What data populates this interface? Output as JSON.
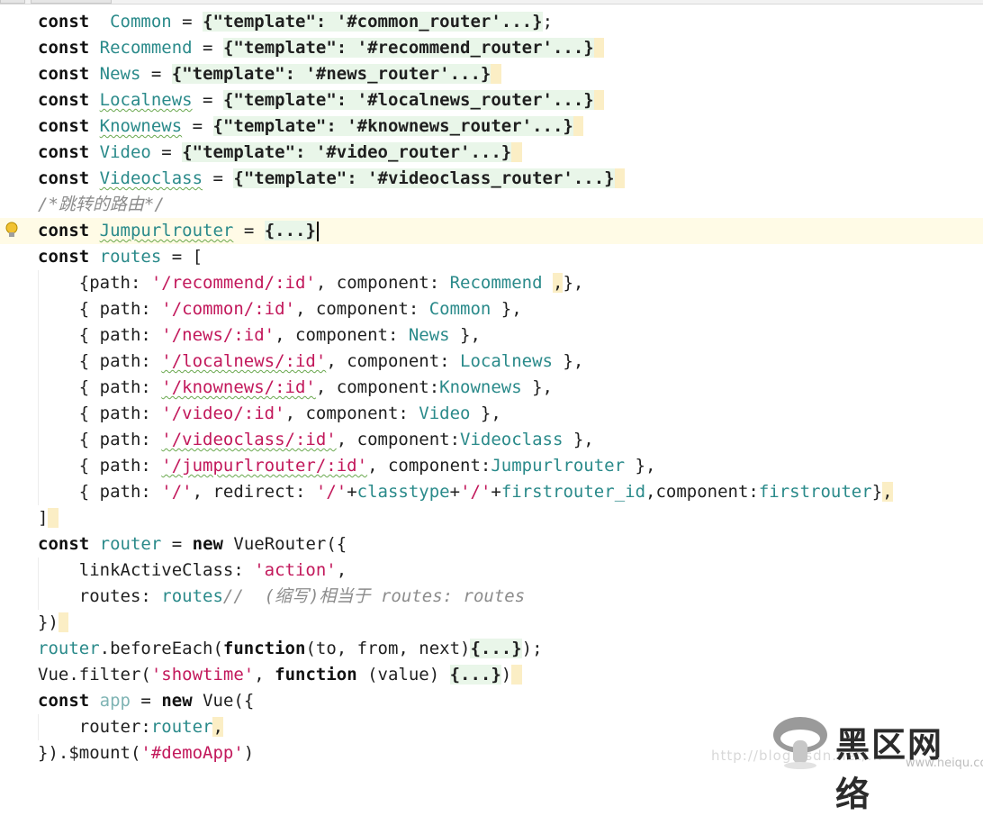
{
  "editor": {
    "language": "javascript",
    "lines": [
      {
        "tokens": [
          {
            "t": "const",
            "c": "kw"
          },
          {
            "t": "  ",
            "c": "plain"
          },
          {
            "t": "Common",
            "c": "ident"
          },
          {
            "t": " = ",
            "c": "plain"
          },
          {
            "t": "{\"template\": '#common_router'...}",
            "c": "foldstr"
          },
          {
            "t": ";",
            "c": "plain"
          }
        ]
      },
      {
        "tokens": [
          {
            "t": "const",
            "c": "kw"
          },
          {
            "t": " ",
            "c": "plain"
          },
          {
            "t": "Recommend",
            "c": "ident"
          },
          {
            "t": " = ",
            "c": "plain"
          },
          {
            "t": "{\"template\": '#recommend_router'...}",
            "c": "foldstr"
          },
          {
            "t": " ",
            "c": "hl"
          }
        ]
      },
      {
        "tokens": [
          {
            "t": "const",
            "c": "kw"
          },
          {
            "t": " ",
            "c": "plain"
          },
          {
            "t": "News",
            "c": "ident"
          },
          {
            "t": " = ",
            "c": "plain"
          },
          {
            "t": "{\"template\": '#news_router'...}",
            "c": "foldstr"
          },
          {
            "t": " ",
            "c": "hl"
          }
        ]
      },
      {
        "tokens": [
          {
            "t": "const",
            "c": "kw"
          },
          {
            "t": " ",
            "c": "plain"
          },
          {
            "t": "Localnews",
            "c": "ident squig"
          },
          {
            "t": " = ",
            "c": "plain"
          },
          {
            "t": "{\"template\": '#localnews_router'...}",
            "c": "foldstr"
          },
          {
            "t": " ",
            "c": "hl"
          }
        ]
      },
      {
        "tokens": [
          {
            "t": "const",
            "c": "kw"
          },
          {
            "t": " ",
            "c": "plain"
          },
          {
            "t": "Knownews",
            "c": "ident squig"
          },
          {
            "t": " = ",
            "c": "plain"
          },
          {
            "t": "{\"template\": '#knownews_router'...}",
            "c": "foldstr"
          },
          {
            "t": " ",
            "c": "hl"
          }
        ]
      },
      {
        "tokens": [
          {
            "t": "const",
            "c": "kw"
          },
          {
            "t": " ",
            "c": "plain"
          },
          {
            "t": "Video",
            "c": "ident"
          },
          {
            "t": " = ",
            "c": "plain"
          },
          {
            "t": "{\"template\": '#video_router'...}",
            "c": "foldstr"
          },
          {
            "t": " ",
            "c": "hl"
          }
        ]
      },
      {
        "tokens": [
          {
            "t": "const",
            "c": "kw"
          },
          {
            "t": " ",
            "c": "plain"
          },
          {
            "t": "Videoclass",
            "c": "ident squig"
          },
          {
            "t": " = ",
            "c": "plain"
          },
          {
            "t": "{\"template\": '#videoclass_router'...}",
            "c": "foldstr"
          },
          {
            "t": " ",
            "c": "hl"
          }
        ]
      },
      {
        "tokens": [
          {
            "t": "/*跳转的路由*/",
            "c": "cm"
          }
        ]
      },
      {
        "current": true,
        "bulb": true,
        "tokens": [
          {
            "t": "const",
            "c": "kw"
          },
          {
            "t": " ",
            "c": "plain"
          },
          {
            "t": "Jumpurlrouter",
            "c": "ident squig"
          },
          {
            "t": " = ",
            "c": "plain"
          },
          {
            "t": "{...}",
            "c": "fold"
          },
          {
            "t": "",
            "c": "caret"
          }
        ]
      },
      {
        "tokens": [
          {
            "t": "const",
            "c": "kw"
          },
          {
            "t": " ",
            "c": "plain"
          },
          {
            "t": "routes",
            "c": "ident"
          },
          {
            "t": " = [",
            "c": "plain"
          }
        ]
      },
      {
        "guide": true,
        "tokens": [
          {
            "t": "    {path: ",
            "c": "plain"
          },
          {
            "t": "'/recommend/:id'",
            "c": "str"
          },
          {
            "t": ", component: ",
            "c": "plain"
          },
          {
            "t": "Recommend",
            "c": "ident"
          },
          {
            "t": " ",
            "c": "plain"
          },
          {
            "t": ",",
            "c": "hl"
          },
          {
            "t": "},",
            "c": "plain"
          }
        ]
      },
      {
        "guide": true,
        "tokens": [
          {
            "t": "    { path: ",
            "c": "plain"
          },
          {
            "t": "'/common/:id'",
            "c": "str"
          },
          {
            "t": ", component: ",
            "c": "plain"
          },
          {
            "t": "Common",
            "c": "ident"
          },
          {
            "t": " },",
            "c": "plain"
          }
        ]
      },
      {
        "guide": true,
        "tokens": [
          {
            "t": "    { path: ",
            "c": "plain"
          },
          {
            "t": "'/news/:id'",
            "c": "str"
          },
          {
            "t": ", component: ",
            "c": "plain"
          },
          {
            "t": "News",
            "c": "ident"
          },
          {
            "t": " },",
            "c": "plain"
          }
        ]
      },
      {
        "guide": true,
        "tokens": [
          {
            "t": "    { path: ",
            "c": "plain"
          },
          {
            "t": "'/localnews/:id'",
            "c": "str squig"
          },
          {
            "t": ", component: ",
            "c": "plain"
          },
          {
            "t": "Localnews",
            "c": "ident"
          },
          {
            "t": " },",
            "c": "plain"
          }
        ]
      },
      {
        "guide": true,
        "tokens": [
          {
            "t": "    { path: ",
            "c": "plain"
          },
          {
            "t": "'/knownews/:id'",
            "c": "str squig"
          },
          {
            "t": ", component:",
            "c": "plain"
          },
          {
            "t": "Knownews",
            "c": "ident"
          },
          {
            "t": " },",
            "c": "plain"
          }
        ]
      },
      {
        "guide": true,
        "tokens": [
          {
            "t": "    { path: ",
            "c": "plain"
          },
          {
            "t": "'/video/:id'",
            "c": "str"
          },
          {
            "t": ", component: ",
            "c": "plain"
          },
          {
            "t": "Video",
            "c": "ident"
          },
          {
            "t": " },",
            "c": "plain"
          }
        ]
      },
      {
        "guide": true,
        "tokens": [
          {
            "t": "    { path: ",
            "c": "plain"
          },
          {
            "t": "'/videoclass/:id'",
            "c": "str squig"
          },
          {
            "t": ", component:",
            "c": "plain"
          },
          {
            "t": "Videoclass",
            "c": "ident"
          },
          {
            "t": " },",
            "c": "plain"
          }
        ]
      },
      {
        "guide": true,
        "tokens": [
          {
            "t": "    { path: ",
            "c": "plain"
          },
          {
            "t": "'/jumpurlrouter/:id'",
            "c": "str squig"
          },
          {
            "t": ", component:",
            "c": "plain"
          },
          {
            "t": "Jumpurlrouter",
            "c": "ident"
          },
          {
            "t": " },",
            "c": "plain"
          }
        ]
      },
      {
        "guide": true,
        "tokens": [
          {
            "t": "    { path: ",
            "c": "plain"
          },
          {
            "t": "'/'",
            "c": "str"
          },
          {
            "t": ", redirect: ",
            "c": "plain"
          },
          {
            "t": "'/'",
            "c": "str"
          },
          {
            "t": "+",
            "c": "plain"
          },
          {
            "t": "classtype",
            "c": "ident"
          },
          {
            "t": "+",
            "c": "plain"
          },
          {
            "t": "'/'",
            "c": "str"
          },
          {
            "t": "+",
            "c": "plain"
          },
          {
            "t": "firstrouter_id",
            "c": "ident"
          },
          {
            "t": ",component:",
            "c": "plain"
          },
          {
            "t": "firstrouter",
            "c": "ident"
          },
          {
            "t": "}",
            "c": "plain"
          },
          {
            "t": ",",
            "c": "hl"
          }
        ]
      },
      {
        "tokens": [
          {
            "t": "]",
            "c": "plain"
          },
          {
            "t": " ",
            "c": "hl"
          }
        ]
      },
      {
        "tokens": [
          {
            "t": "const",
            "c": "kw"
          },
          {
            "t": " ",
            "c": "plain"
          },
          {
            "t": "router",
            "c": "ident"
          },
          {
            "t": " = ",
            "c": "plain"
          },
          {
            "t": "new",
            "c": "kw"
          },
          {
            "t": " VueRouter({",
            "c": "plain"
          }
        ]
      },
      {
        "guide": true,
        "tokens": [
          {
            "t": "    linkActiveClass: ",
            "c": "plain"
          },
          {
            "t": "'action'",
            "c": "str"
          },
          {
            "t": ",",
            "c": "plain"
          }
        ]
      },
      {
        "guide": true,
        "tokens": [
          {
            "t": "    routes: ",
            "c": "plain"
          },
          {
            "t": "routes",
            "c": "ident"
          },
          {
            "t": "//  (缩写)相当于 routes: routes",
            "c": "cm"
          }
        ]
      },
      {
        "tokens": [
          {
            "t": "})",
            "c": "plain"
          },
          {
            "t": " ",
            "c": "hl"
          }
        ]
      },
      {
        "tokens": [
          {
            "t": "router",
            "c": "ident"
          },
          {
            "t": ".beforeEach(",
            "c": "plain"
          },
          {
            "t": "function",
            "c": "kw"
          },
          {
            "t": "(to, from, next)",
            "c": "plain"
          },
          {
            "t": "{...}",
            "c": "fold"
          },
          {
            "t": ");",
            "c": "plain"
          }
        ]
      },
      {
        "tokens": [
          {
            "t": "Vue.filter(",
            "c": "plain"
          },
          {
            "t": "'showtime'",
            "c": "str"
          },
          {
            "t": ", ",
            "c": "plain"
          },
          {
            "t": "function",
            "c": "kw"
          },
          {
            "t": " (value) ",
            "c": "plain"
          },
          {
            "t": "{...}",
            "c": "fold"
          },
          {
            "t": ")",
            "c": "plain"
          },
          {
            "t": " ",
            "c": "hl"
          }
        ]
      },
      {
        "tokens": [
          {
            "t": "const",
            "c": "kw"
          },
          {
            "t": " ",
            "c": "plain"
          },
          {
            "t": "app",
            "c": "ident dim"
          },
          {
            "t": " = ",
            "c": "plain"
          },
          {
            "t": "new",
            "c": "kw"
          },
          {
            "t": " Vue({",
            "c": "plain"
          }
        ]
      },
      {
        "guide": true,
        "tokens": [
          {
            "t": "    router:",
            "c": "plain"
          },
          {
            "t": "router",
            "c": "ident"
          },
          {
            "t": ",",
            "c": "hl"
          }
        ]
      },
      {
        "tokens": [
          {
            "t": "}).$mount(",
            "c": "plain"
          },
          {
            "t": "'#demoApp'",
            "c": "str"
          },
          {
            "t": ")",
            "c": "plain"
          }
        ]
      }
    ]
  },
  "watermark": {
    "url": "http://blog.csdn.net/...",
    "logo_text": "黑区网络",
    "logo_sub": "www.heiqu.com"
  },
  "colors": {
    "keyword": "#111111",
    "identifier": "#2a8a8a",
    "string": "#c2185b",
    "comment": "#8c8c8c",
    "fold_bg": "#e9f6e9",
    "highlight_bg": "#fbeec5",
    "current_line_bg": "#fffbe6"
  },
  "icons": {
    "gutter": "lightbulb-icon"
  }
}
